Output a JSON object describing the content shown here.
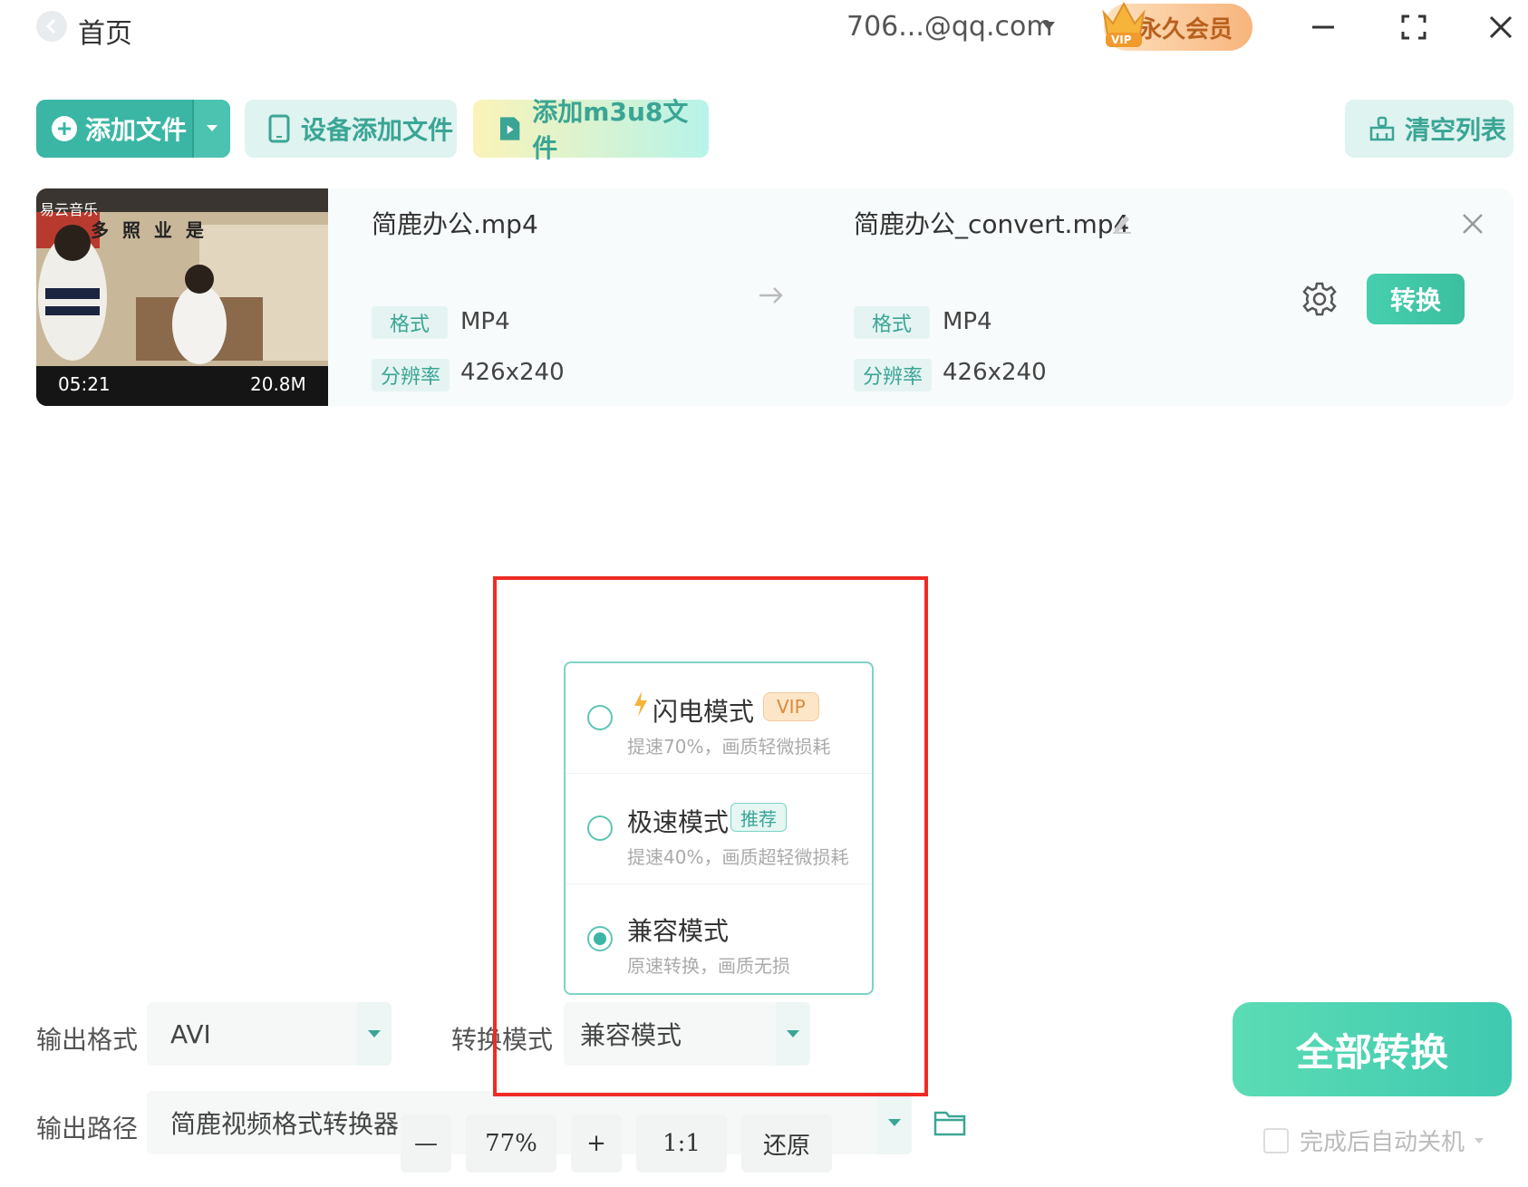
{
  "titlebar": {
    "home_label": "首页",
    "account": "706...@qq.com",
    "vip_label": "永久会员",
    "vip_crown_text": "VIP"
  },
  "toolbar": {
    "add_file": "添加文件",
    "device_add": "设备添加文件",
    "m3u8_add": "添加m3u8文件",
    "clear_list": "清空列表"
  },
  "file": {
    "thumb_brand": "易云音乐",
    "thumb_subtitle": "多 照 业 是",
    "duration": "05:21",
    "size": "20.8M",
    "source_name": "简鹿办公.mp4",
    "output_name": "简鹿办公_convert.mp4",
    "format_tag": "格式",
    "resolution_tag": "分辨率",
    "source_format": "MP4",
    "source_resolution": "426x240",
    "output_format": "MP4",
    "output_resolution": "426x240",
    "convert_label": "转换"
  },
  "mode_dropdown": {
    "items": [
      {
        "title": "闪电模式",
        "badge": "VIP",
        "desc": "提速70%，画质轻微损耗",
        "selected": false
      },
      {
        "title": "极速模式",
        "badge": "推荐",
        "desc": "提速40%，画质超轻微损耗",
        "selected": false
      },
      {
        "title": "兼容模式",
        "badge": "",
        "desc": "原速转换，画质无损",
        "selected": true
      }
    ]
  },
  "bottom": {
    "output_format_label": "输出格式",
    "output_format_value": "AVI",
    "convert_mode_label": "转换模式",
    "convert_mode_value": "兼容模式",
    "output_path_label": "输出路径",
    "output_path_value": "简鹿视频格式转换器",
    "zoom_out": "—",
    "zoom_level": "77%",
    "zoom_in": "+",
    "zoom_one": "1:1",
    "zoom_reset": "还原",
    "all_convert": "全部转换",
    "shutdown_label": "完成后自动关机"
  },
  "colors": {
    "accent": "#3bb6a4",
    "highlight_box": "#ee2b24",
    "vip": "#f8b47c"
  }
}
